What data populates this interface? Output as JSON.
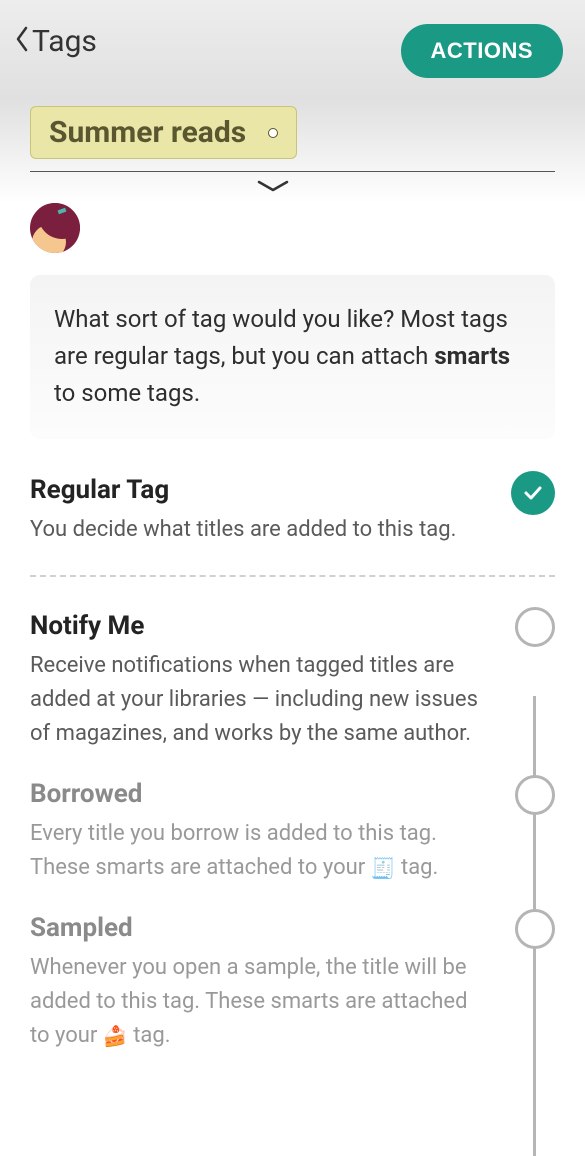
{
  "header": {
    "back_label": "Tags",
    "actions_label": "ACTIONS"
  },
  "tag": {
    "name": "Summer reads"
  },
  "info": {
    "text_before_bold": "What sort of tag would you like? Most tags are regular tags, but you can attach ",
    "bold_word": "smarts",
    "text_after_bold": " to some tags."
  },
  "options": {
    "regular": {
      "title": "Regular Tag",
      "desc": "You decide what titles are added to this tag."
    },
    "notify": {
      "title": "Notify Me",
      "desc": "Receive notifications when tagged titles are added at your libraries — including new issues of magazines, and works by the same author."
    },
    "borrowed": {
      "title": "Borrowed",
      "desc_before": "Every title you borrow is added to this tag. These smarts are attached to your ",
      "icon": "🧾",
      "desc_after": " tag."
    },
    "sampled": {
      "title": "Sampled",
      "desc_before": "Whenever you open a sample, the title will be added to this tag. These smarts are attached to your ",
      "icon": "🍰",
      "desc_after": " tag."
    }
  }
}
